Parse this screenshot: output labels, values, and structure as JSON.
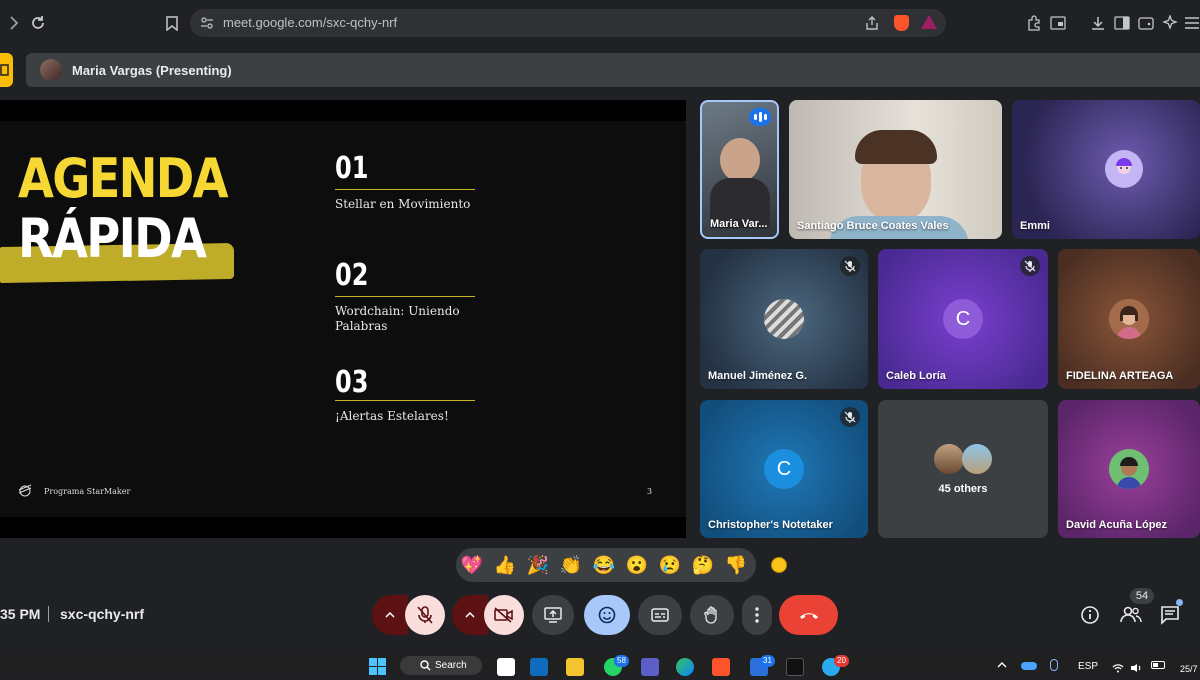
{
  "browser": {
    "url": "meet.google.com/sxc-qchy-nrf"
  },
  "presenting": {
    "label": "Maria Vargas (Presenting)"
  },
  "slide": {
    "title_line1": "AGENDA",
    "title_line2": "RÁPIDA",
    "items": [
      {
        "number": "01",
        "text": "Stellar en Movimiento"
      },
      {
        "number": "02",
        "text": "Wordchain: Uniendo Palabras"
      },
      {
        "number": "03",
        "text": "¡Alertas Estelares!"
      }
    ],
    "footer": "Programa StarMaker",
    "page": "3",
    "accent": "#f5d833"
  },
  "participants": [
    {
      "name": "Maria Var...",
      "speaking": true
    },
    {
      "name": "Santiago Bruce Coates Vales"
    },
    {
      "name": "Emmi"
    },
    {
      "name": "Manuel Jiménez G.",
      "muted": true
    },
    {
      "name": "Caleb Loría",
      "initial": "C",
      "muted": true
    },
    {
      "name": "FIDELINA ARTEAGA"
    },
    {
      "name": "Christopher's Notetaker",
      "initial": "C",
      "muted": true
    },
    {
      "name": "45 others"
    },
    {
      "name": "David Acuña López"
    }
  ],
  "reactions": [
    "💖",
    "👍",
    "🎉",
    "👏",
    "😂",
    "😮",
    "😢",
    "🤔",
    "👎"
  ],
  "meeting": {
    "time": "35 PM",
    "code": "sxc-qchy-nrf",
    "participant_count": "54"
  },
  "taskbar": {
    "search_label": "Search",
    "language": "ESP",
    "date_partial": "25/7",
    "whatsapp_badge": "58",
    "app_badge": "31",
    "telegram_badge": "20"
  },
  "colors": {
    "end_call": "#ea4335",
    "active_blue": "#a8c7fa",
    "muted_bg": "#f9dedc"
  }
}
